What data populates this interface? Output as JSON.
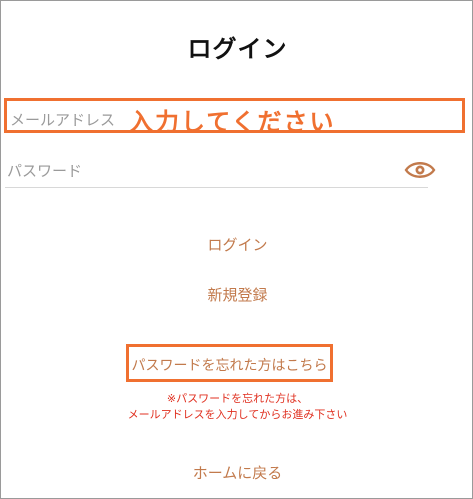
{
  "header": {
    "title": "ログイン"
  },
  "form": {
    "email_label": "メールアドレス",
    "email_annotation": "入力してください",
    "password_label": "パスワード",
    "password_toggle_icon": "eye-icon",
    "accent_color": "#f07030",
    "link_color": "#c27a4c"
  },
  "actions": {
    "login": "ログイン",
    "register": "新規登録",
    "forgot_password": "パスワードを忘れた方はこちら",
    "home": "ホームに戻る"
  },
  "notice": {
    "line1": "※パスワードを忘れた方は、",
    "line2": "メールアドレスを入力してからお進み下さい",
    "color": "#e03020"
  }
}
